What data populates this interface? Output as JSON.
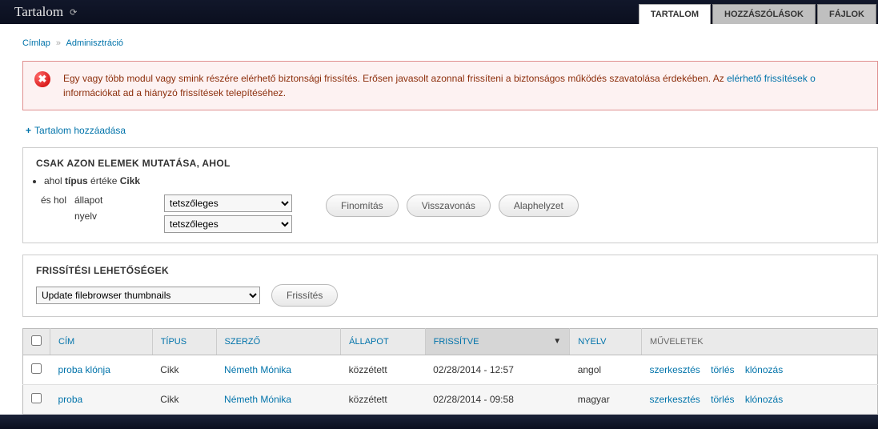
{
  "topbar": {
    "title": "Tartalom",
    "tabs": [
      {
        "label": "TARTALOM",
        "active": true
      },
      {
        "label": "HOZZÁSZÓLÁSOK",
        "active": false
      },
      {
        "label": "FÁJLOK",
        "active": false
      }
    ]
  },
  "breadcrumb": {
    "home": "Címlap",
    "current": "Adminisztráció"
  },
  "alert": {
    "text_before_link": "Egy vagy több modul vagy smink részére elérhető biztonsági frissítés. Erősen javasolt azonnal frissíteni a biztonságos működés szavatolása érdekében. Az ",
    "link_text": "elérhető frissítések o",
    "text_after_link": "információkat ad a hiányzó frissítések telepítéséhez."
  },
  "add_link": "Tartalom hozzáadása",
  "filter_panel": {
    "title": "CSAK AZON ELEMEK MUTATÁSA, AHOL",
    "bullet_prefix": "ahol ",
    "bullet_field": "típus",
    "bullet_mid": " értéke ",
    "bullet_value": "Cikk",
    "and_where": "és hol",
    "status_label": "állapot",
    "lang_label": "nyelv",
    "status_value": "tetszőleges",
    "lang_value": "tetszőleges",
    "btn_refine": "Finomítás",
    "btn_undo": "Visszavonás",
    "btn_reset": "Alaphelyzet"
  },
  "update_panel": {
    "title": "FRISSÍTÉSI LEHETŐSÉGEK",
    "select_value": "Update filebrowser thumbnails",
    "btn": "Frissítés"
  },
  "table": {
    "headers": {
      "title": "CÍM",
      "type": "TÍPUS",
      "author": "SZERZŐ",
      "status": "ÁLLAPOT",
      "updated": "FRISSÍTVE",
      "lang": "NYELV",
      "ops": "MŰVELETEK"
    },
    "rows": [
      {
        "title": "proba klónja",
        "type": "Cikk",
        "author": "Németh Mónika",
        "status": "közzétett",
        "updated": "02/28/2014 - 12:57",
        "lang": "angol"
      },
      {
        "title": "proba",
        "type": "Cikk",
        "author": "Németh Mónika",
        "status": "közzétett",
        "updated": "02/28/2014 - 09:58",
        "lang": "magyar"
      }
    ],
    "op_edit": "szerkesztés",
    "op_delete": "törlés",
    "op_clone": "klónozás"
  }
}
